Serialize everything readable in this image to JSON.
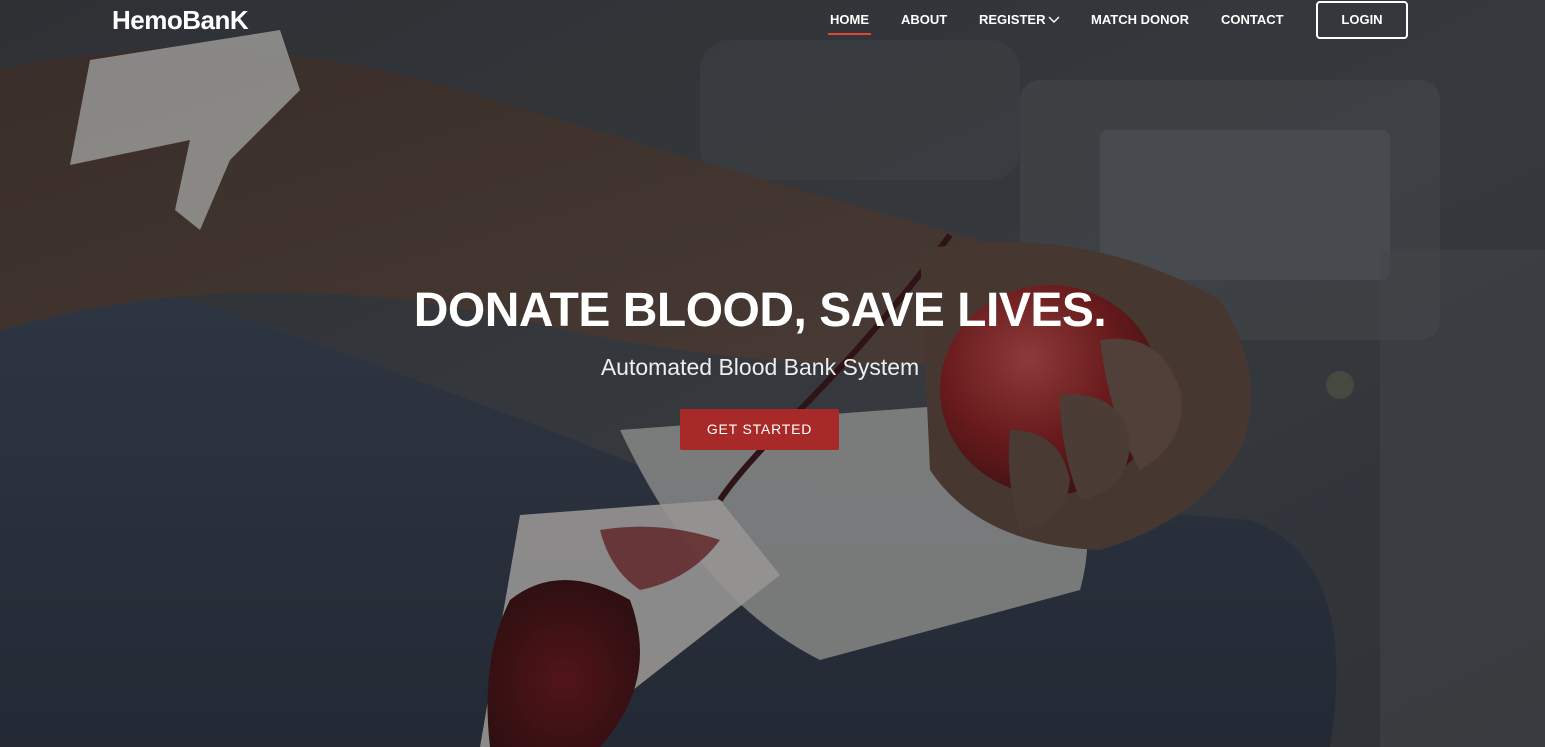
{
  "brand": {
    "name": "HemoBanK"
  },
  "nav": {
    "items": [
      {
        "label": "HOME",
        "active": true
      },
      {
        "label": "ABOUT",
        "active": false
      },
      {
        "label": "REGISTER",
        "active": false,
        "has_dropdown": true
      },
      {
        "label": "MATCH DONOR",
        "active": false
      },
      {
        "label": "CONTACT",
        "active": false
      }
    ],
    "login_label": "LOGIN"
  },
  "hero": {
    "headline": "DONATE BLOOD, SAVE LIVES.",
    "subheadline": "Automated Blood Bank System",
    "cta_label": "GET STARTED",
    "background_description": "blood donation arm squeezing red stress ball, blood bag",
    "overlay_color": "#14161a"
  },
  "colors": {
    "accent": "#e0492f",
    "cta_bg": "#a72a28",
    "text": "#ffffff"
  },
  "icons": {
    "register_dropdown": "chevron-down-icon"
  }
}
